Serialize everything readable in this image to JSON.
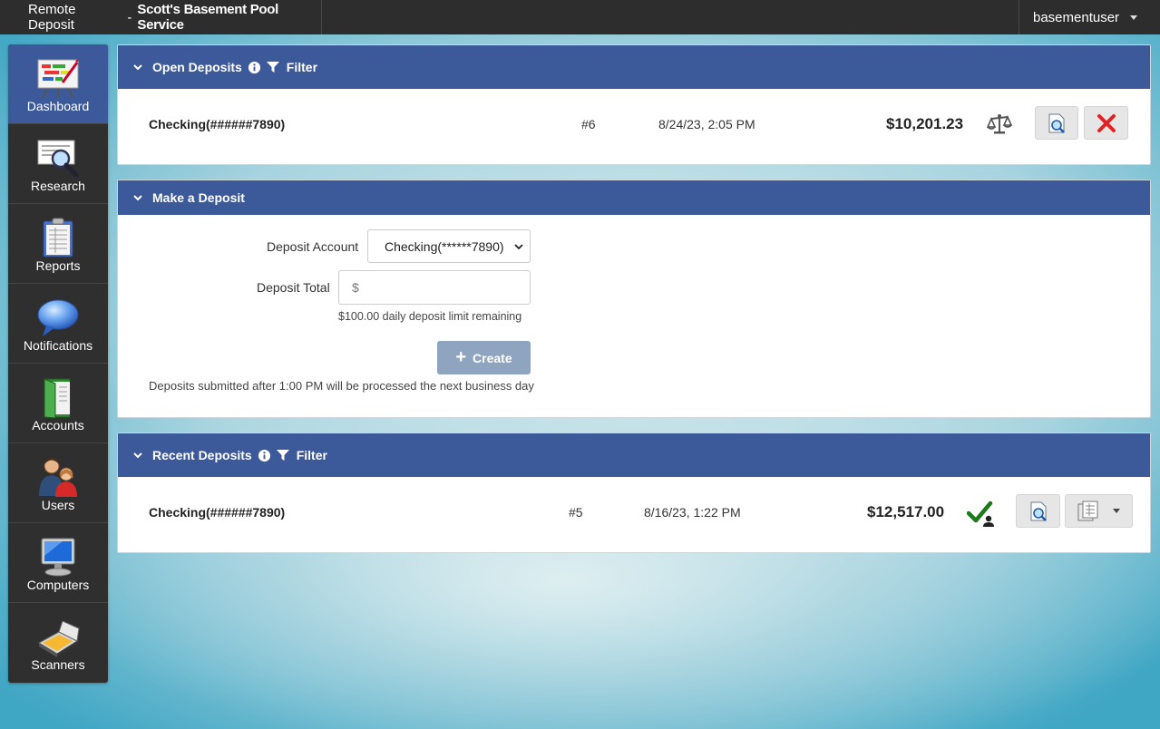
{
  "header": {
    "app_name": "Remote Deposit",
    "separator": "-",
    "company": "Scott's Basement Pool Service",
    "user": "basementuser"
  },
  "sidebar": {
    "items": [
      {
        "label": "Dashboard",
        "icon": "dashboard-icon",
        "active": true
      },
      {
        "label": "Research",
        "icon": "research-icon"
      },
      {
        "label": "Reports",
        "icon": "reports-icon"
      },
      {
        "label": "Notifications",
        "icon": "notifications-icon"
      },
      {
        "label": "Accounts",
        "icon": "accounts-icon"
      },
      {
        "label": "Users",
        "icon": "users-icon"
      },
      {
        "label": "Computers",
        "icon": "computers-icon"
      },
      {
        "label": "Scanners",
        "icon": "scanners-icon"
      }
    ]
  },
  "open_deposits": {
    "title": "Open Deposits",
    "filter_label": "Filter",
    "rows": [
      {
        "account": "Checking(######7890)",
        "number": "#6",
        "datetime": "8/24/23, 2:05 PM",
        "amount": "$10,201.23"
      }
    ]
  },
  "make_deposit": {
    "title": "Make a Deposit",
    "account_label": "Deposit Account",
    "account_value": "Checking(******7890)",
    "total_label": "Deposit Total",
    "total_prefix": "$",
    "total_value": "",
    "limit_hint": "$100.00 daily deposit limit remaining",
    "create_label": "Create",
    "cutoff_note": "Deposits submitted after 1:00 PM will be processed the next business day"
  },
  "recent_deposits": {
    "title": "Recent Deposits",
    "filter_label": "Filter",
    "rows": [
      {
        "account": "Checking(######7890)",
        "number": "#5",
        "datetime": "8/16/23, 1:22 PM",
        "amount": "$12,517.00"
      }
    ]
  },
  "colors": {
    "topbar": "#2d2d2d",
    "sidebar": "#2f2f2f",
    "accent": "#3c5a99",
    "create_button": "#8fa5bf",
    "delete_red": "#e02424",
    "check_green": "#1a7a1a"
  }
}
